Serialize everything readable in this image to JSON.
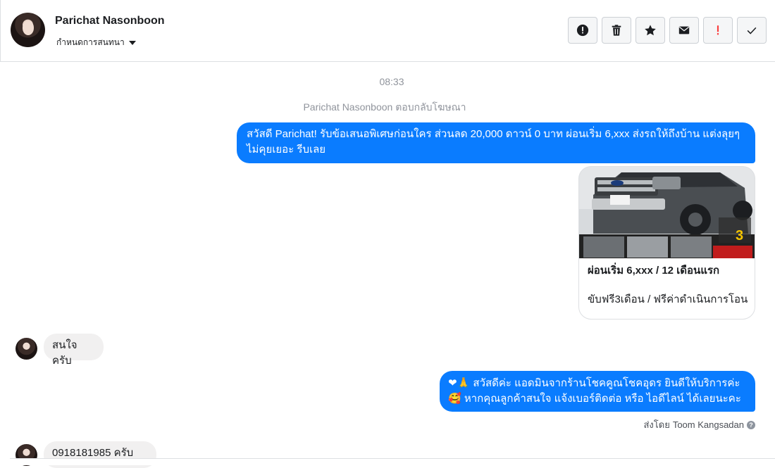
{
  "header": {
    "contact_name": "Parichat Nasonboon",
    "assign_label": "กำหนดการสนทนา",
    "actions": [
      {
        "name": "report-icon",
        "color": "#1c1e21"
      },
      {
        "name": "trash-icon",
        "color": "#1c1e21"
      },
      {
        "name": "star-icon",
        "color": "#1c1e21"
      },
      {
        "name": "envelope-icon",
        "color": "#1c1e21"
      },
      {
        "name": "exclamation-icon",
        "color": "#fa3e3e"
      },
      {
        "name": "check-icon",
        "color": "#1c1e21"
      }
    ]
  },
  "thread": {
    "timestamp": "08:33",
    "system_note": "Parichat Nasonboon ตอบกลับโฆษณา",
    "msg1": "สวัสดี Parichat! รับข้อเสนอพิเศษก่อนใคร ส่วนลด 20,000 ดาวน์ 0 บาท ผ่อนเริ่ม 6,xxx ส่งรถให้ถึงบ้าน แต่งลุยๆไม่คุยเยอะ รีบเลย",
    "card": {
      "title": "ผ่อนเริ่ม 6,xxx / 12 เดือนแรก",
      "subtitle": "ขับฟรี3เดือน / ฟรีค่าดำเนินการโอน",
      "image_badge": "3"
    },
    "reply1": "สนใจครับ",
    "msg2": "❤🙏 สวัสดีค่ะ แอดมินจากร้านโชคคูณโชคอุดร ยินดีให้บริการค่ะ🥰 หากคุณลูกค้าสนใจ แจ้งเบอร์ติดต่อ หรือ ไอดีไลน์ ได้เลยนะคะ",
    "sent_by_label": "ส่งโดย",
    "sent_by_name": "Toom Kangsadan",
    "reply2": "0918181985 ครับ"
  },
  "colors": {
    "outgoing_bubble": "#0a7cff",
    "incoming_bubble": "#f1f0f0"
  }
}
